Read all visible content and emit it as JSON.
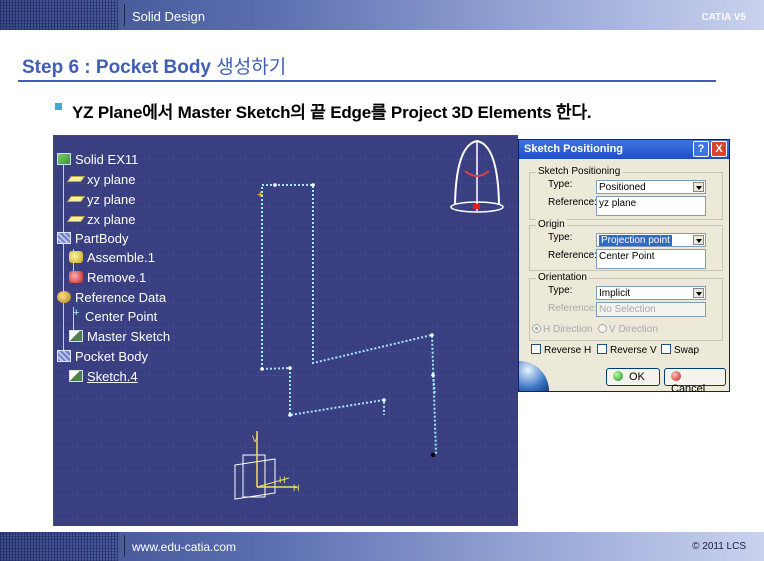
{
  "header": {
    "title": "Solid Design",
    "brand": "CATIA V5"
  },
  "step": {
    "title": "Step 6 : Pocket Body",
    "title_kr": "생성하기"
  },
  "instruction": "YZ Plane에서 Master Sketch의 끝 Edge를 Project 3D Elements 한다.",
  "colors": {
    "step_blue": "#3f5fb6",
    "viewport_bg": "#3a3f82",
    "sketch_edge": "#9fe6ff",
    "dialog_title": "#1f4fc4"
  },
  "tree": {
    "items": [
      {
        "label": "Solid EX11",
        "icon": "part-icon"
      },
      {
        "label": "xy plane",
        "icon": "plane-icon"
      },
      {
        "label": "yz plane",
        "icon": "plane-icon"
      },
      {
        "label": "zx plane",
        "icon": "plane-icon"
      },
      {
        "label": "PartBody",
        "icon": "body-icon"
      },
      {
        "label": "Assemble.1",
        "icon": "assemble-icon"
      },
      {
        "label": "Remove.1",
        "icon": "remove-icon"
      },
      {
        "label": "Reference Data",
        "icon": "reference-icon"
      },
      {
        "label": "Center Point",
        "icon": "point-icon"
      },
      {
        "label": "Master Sketch",
        "icon": "sketch-icon"
      },
      {
        "label": "Pocket Body",
        "icon": "body-icon"
      },
      {
        "label": "Sketch.4",
        "icon": "sketch-icon"
      }
    ]
  },
  "dialog": {
    "title": "Sketch Positioning",
    "help_btn": "?",
    "close_btn": "X",
    "positioning": {
      "group": "Sketch Positioning",
      "type_label": "Type:",
      "type_value": "Positioned",
      "ref_label": "Reference:",
      "ref_value": "yz plane"
    },
    "origin": {
      "group": "Origin",
      "type_label": "Type:",
      "type_value": "Projection point",
      "ref_label": "Reference:",
      "ref_value": "Center Point"
    },
    "orientation": {
      "group": "Orientation",
      "type_label": "Type:",
      "type_value": "Implicit",
      "ref_label": "Reference:",
      "ref_value": "No Selection",
      "h_dir": "H Direction",
      "v_dir": "V Direction"
    },
    "options": {
      "reverse_h": "Reverse H",
      "reverse_v": "Reverse V",
      "swap": "Swap"
    },
    "ok": "OK",
    "cancel": "Cancel"
  },
  "footer": {
    "site": "www.edu-catia.com",
    "copyright": "© 2011 LCS"
  }
}
